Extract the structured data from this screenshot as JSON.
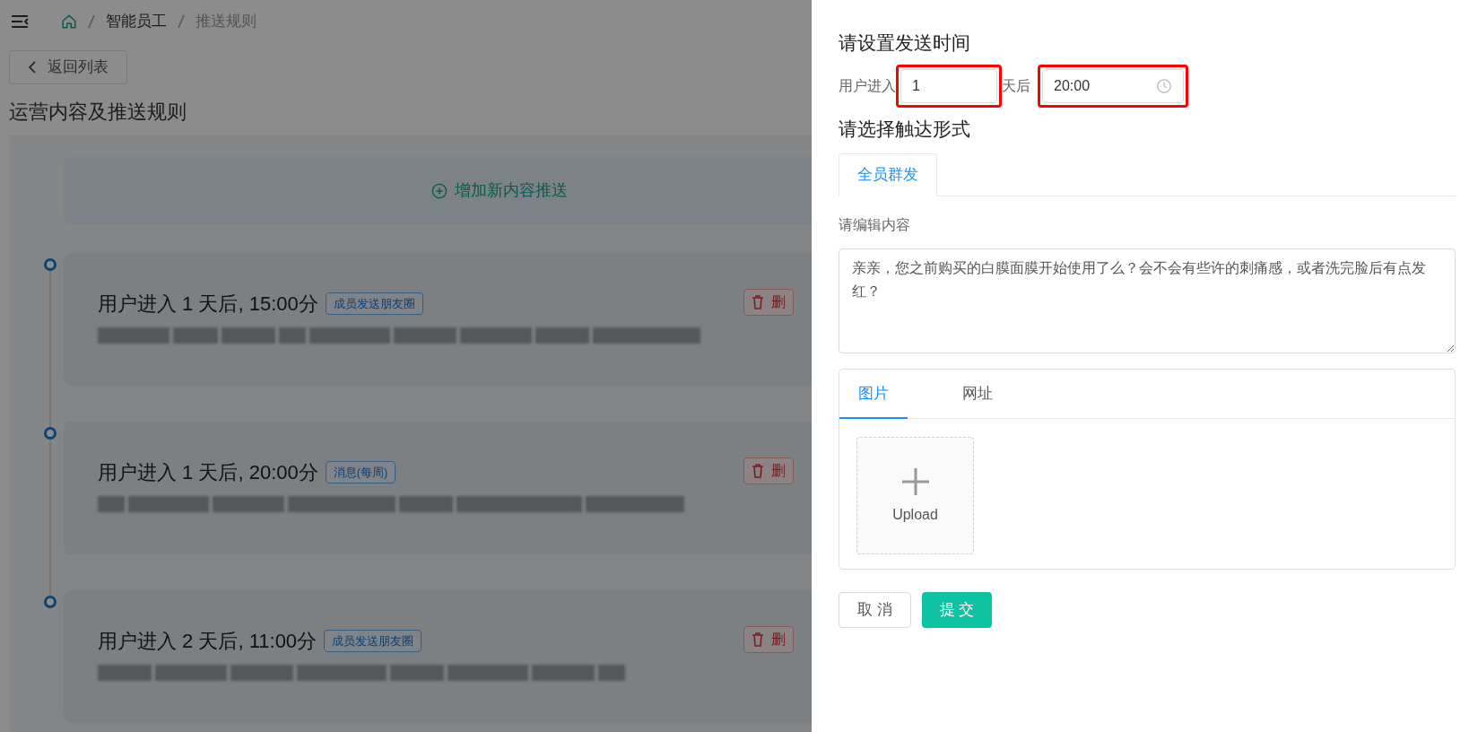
{
  "breadcrumb": [
    {
      "label": "智能员工",
      "current": false
    },
    {
      "label": "推送规则",
      "current": true
    }
  ],
  "back_button": "返回列表",
  "page_title": "运营内容及推送规则",
  "add_button": "增加新内容推送",
  "rules": [
    {
      "title": "用户进入 1 天后, 15:00分",
      "tag": "成员发送朋友圈",
      "delete": "删"
    },
    {
      "title": "用户进入 1 天后, 20:00分",
      "tag": "消息(每周)",
      "delete": "删"
    },
    {
      "title": "用户进入 2 天后, 11:00分",
      "tag": "成员发送朋友圈",
      "delete": "删"
    }
  ],
  "drawer": {
    "time_heading": "请设置发送时间",
    "time_prefix": "用户进入",
    "days_value": "1",
    "time_suffix": "天后",
    "time_value": "20:00",
    "form_heading": "请选择触达形式",
    "channel_tabs": [
      {
        "label": "全员群发",
        "selected": true
      }
    ],
    "content_label": "请编辑内容",
    "content_value": "亲亲，您之前购买的白膜面膜开始使用了么？会不会有些许的刺痛感，或者洗完脸后有点发红？",
    "media_tabs": [
      {
        "label": "图片",
        "selected": true
      },
      {
        "label": "网址",
        "selected": false
      }
    ],
    "upload_label": "Upload",
    "cancel": "取 消",
    "submit": "提 交"
  }
}
